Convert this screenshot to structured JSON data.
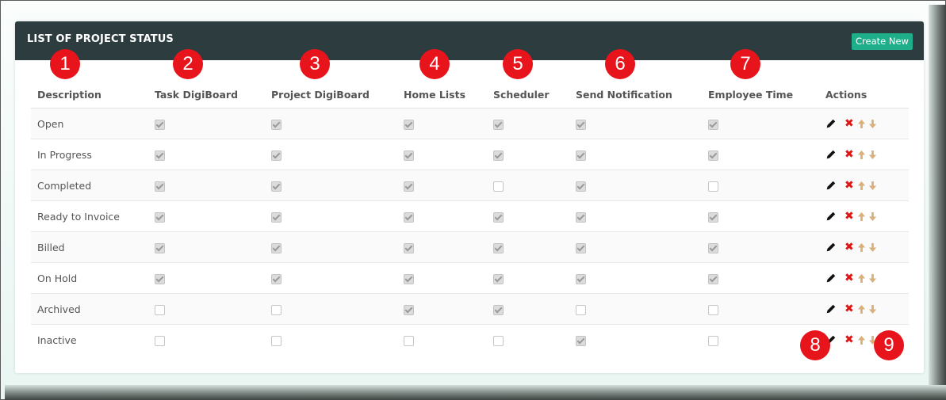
{
  "panel": {
    "title": "LIST OF PROJECT STATUS",
    "create_label": "Create New"
  },
  "columns": [
    "Description",
    "Task DigiBoard",
    "Project DigiBoard",
    "Home Lists",
    "Scheduler",
    "Send Notification",
    "Employee Time",
    "Actions"
  ],
  "rows": [
    {
      "description": "Open",
      "flags": [
        true,
        true,
        true,
        true,
        true,
        true
      ]
    },
    {
      "description": "In Progress",
      "flags": [
        true,
        true,
        true,
        true,
        true,
        true
      ]
    },
    {
      "description": "Completed",
      "flags": [
        true,
        true,
        true,
        false,
        true,
        false
      ]
    },
    {
      "description": "Ready to Invoice",
      "flags": [
        true,
        true,
        true,
        true,
        true,
        true
      ]
    },
    {
      "description": "Billed",
      "flags": [
        true,
        true,
        true,
        true,
        true,
        true
      ]
    },
    {
      "description": "On Hold",
      "flags": [
        true,
        true,
        true,
        true,
        true,
        true
      ]
    },
    {
      "description": "Archived",
      "flags": [
        false,
        false,
        true,
        true,
        false,
        false
      ]
    },
    {
      "description": "Inactive",
      "flags": [
        false,
        false,
        false,
        false,
        true,
        false
      ]
    }
  ],
  "callouts": [
    "1",
    "2",
    "3",
    "4",
    "5",
    "6",
    "7",
    "8",
    "9"
  ],
  "icons": {
    "edit": "pencil-icon",
    "delete": "delete-x-icon",
    "up": "arrow-up-icon",
    "down": "arrow-down-icon"
  },
  "colors": {
    "header_bg": "#2c3c3f",
    "create_button": "#1fae8a",
    "delete": "#e01616",
    "arrow": "#d9b07a",
    "callout": "#e8141b"
  }
}
